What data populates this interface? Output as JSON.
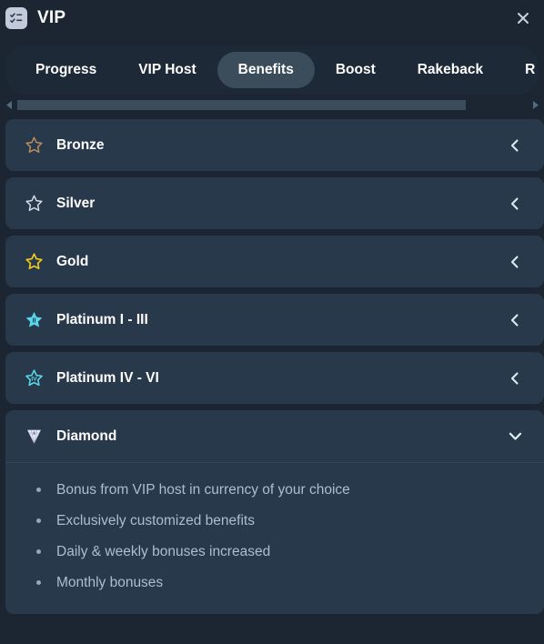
{
  "header": {
    "title": "VIP",
    "app_icon": "checklist-icon",
    "close_icon": "close-icon"
  },
  "tabs": {
    "items": [
      {
        "label": "Progress",
        "active": false
      },
      {
        "label": "VIP Host",
        "active": false
      },
      {
        "label": "Benefits",
        "active": true
      },
      {
        "label": "Boost",
        "active": false
      },
      {
        "label": "Rakeback",
        "active": false
      },
      {
        "label": "R",
        "active": false
      }
    ],
    "scrollbar": {
      "left_arrow_icon": "triangle-left-icon",
      "right_arrow_icon": "triangle-right-icon",
      "thumb_percent": 88
    }
  },
  "tiers": [
    {
      "name": "Bronze",
      "icon": "star-outline-icon",
      "icon_color": "#b98f5e",
      "expanded": false,
      "chevron": "chevron-left-icon",
      "benefits": []
    },
    {
      "name": "Silver",
      "icon": "star-outline-icon",
      "icon_color": "#d5dde7",
      "expanded": false,
      "chevron": "chevron-left-icon",
      "benefits": []
    },
    {
      "name": "Gold",
      "icon": "star-outline-icon",
      "icon_color": "#f2cb1d",
      "expanded": false,
      "chevron": "chevron-left-icon",
      "benefits": []
    },
    {
      "name": "Platinum I - III",
      "icon": "star-filled-numeral-icon",
      "icon_color": "#57d8e8",
      "icon_numeral": "II",
      "expanded": false,
      "chevron": "chevron-left-icon",
      "benefits": []
    },
    {
      "name": "Platinum IV - VI",
      "icon": "star-outline-numeral-icon",
      "icon_color": "#57d8e8",
      "icon_numeral": "IV",
      "expanded": false,
      "chevron": "chevron-left-icon",
      "benefits": []
    },
    {
      "name": "Diamond",
      "icon": "diamond-gem-icon",
      "icon_color": "#e8eaf6",
      "expanded": true,
      "chevron": "chevron-down-icon",
      "benefits": [
        "Bonus from VIP host in currency of your choice",
        "Exclusively customized benefits",
        "Daily & weekly bonuses increased",
        "Monthly bonuses"
      ]
    }
  ],
  "colors": {
    "page_bg": "#1b2632",
    "card_bg": "#27394a",
    "tabbar_bg": "#1d2936",
    "tab_active_bg": "#3b4c5a",
    "text_primary": "#ffffff",
    "text_muted": "#aebdd0"
  }
}
